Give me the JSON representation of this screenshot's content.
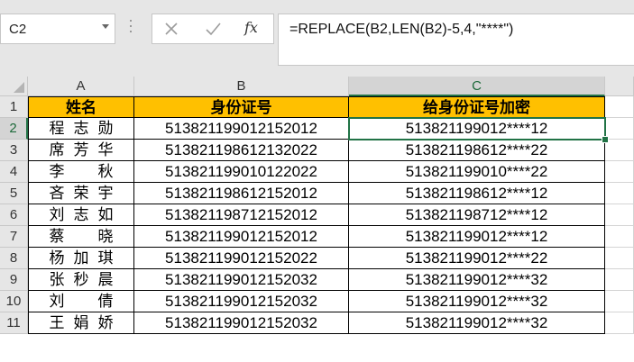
{
  "namebox": {
    "value": "C2"
  },
  "formula_bar": {
    "cancel_icon": "x-icon",
    "enter_icon": "check-icon",
    "fx_label": "fx",
    "formula": "=REPLACE(B2,LEN(B2)-5,4,\"****\")"
  },
  "columns": [
    "A",
    "B",
    "C"
  ],
  "rows": [
    "1",
    "2",
    "3",
    "4",
    "5",
    "6",
    "7",
    "8",
    "9",
    "10",
    "11"
  ],
  "selected_cell": "C2",
  "header_fill_color": "#ffc000",
  "selection_color": "#217346",
  "table": {
    "headers": [
      "姓名",
      "身份证号",
      "给身份证号加密"
    ],
    "data": [
      [
        "程志勋",
        "513821199012152012",
        "513821199012****12"
      ],
      [
        "席芳华",
        "513821198612132022",
        "513821198612****22"
      ],
      [
        "李　秋",
        "513821199010122022",
        "513821199010****22"
      ],
      [
        "吝荣宇",
        "513821198612152012",
        "513821198612****12"
      ],
      [
        "刘志如",
        "513821198712152012",
        "513821198712****12"
      ],
      [
        "蔡　晓",
        "513821199012152012",
        "513821199012****12"
      ],
      [
        "杨加琪",
        "513821199012152022",
        "513821199012****22"
      ],
      [
        "张秒晨",
        "513821199012152032",
        "513821199012****32"
      ],
      [
        "刘　倩",
        "513821199012152032",
        "513821199012****32"
      ],
      [
        "王娟娇",
        "513821199012152032",
        "513821199012****32"
      ]
    ]
  }
}
